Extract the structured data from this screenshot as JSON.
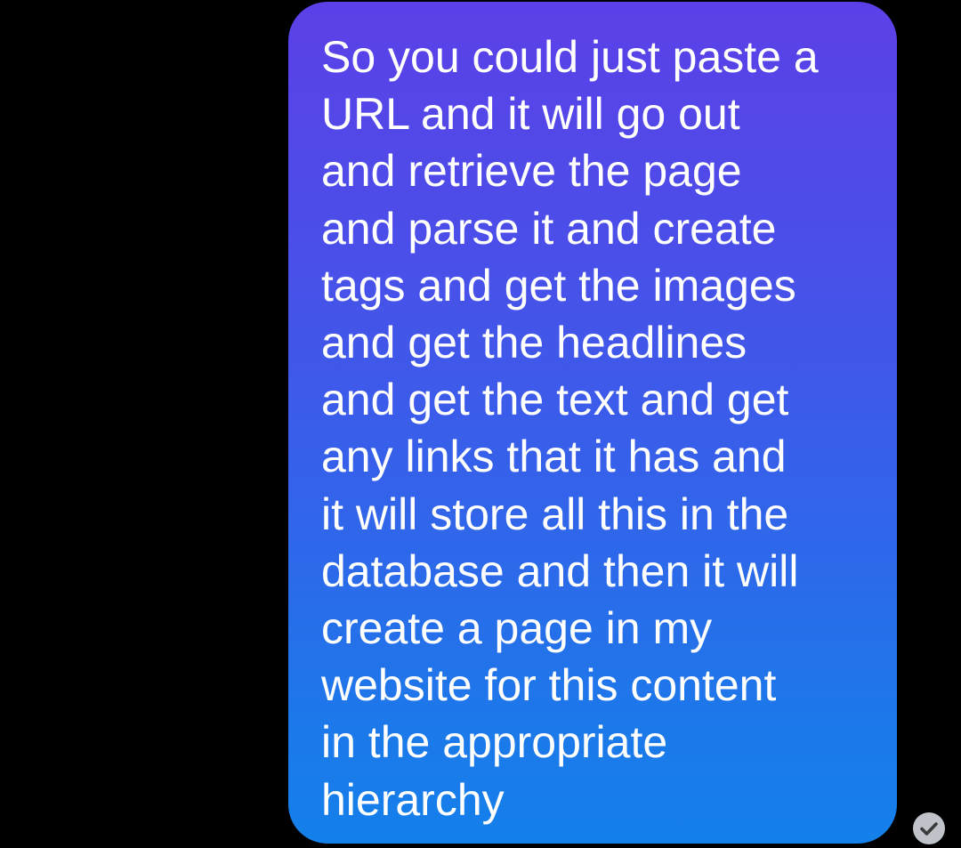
{
  "conversation": {
    "messages": [
      {
        "sender": "self",
        "text": "So you could just paste a\nURL and it will go out\nand retrieve the page\nand parse it and create\ntags and get the images\nand get the headlines\nand get the text and get\nany links that it has and\nit will store all this in the\ndatabase and then it will\ncreate a page in my\nwebsite for this content\nin the appropriate\nhierarchy",
        "status_icon": "check-circle-icon"
      }
    ]
  },
  "colors": {
    "background": "#000000",
    "bubble_gradient_top": "#5b40e8",
    "bubble_gradient_bottom": "#1480ea",
    "text": "#ffffff",
    "receipt": "#bfc3c9"
  }
}
